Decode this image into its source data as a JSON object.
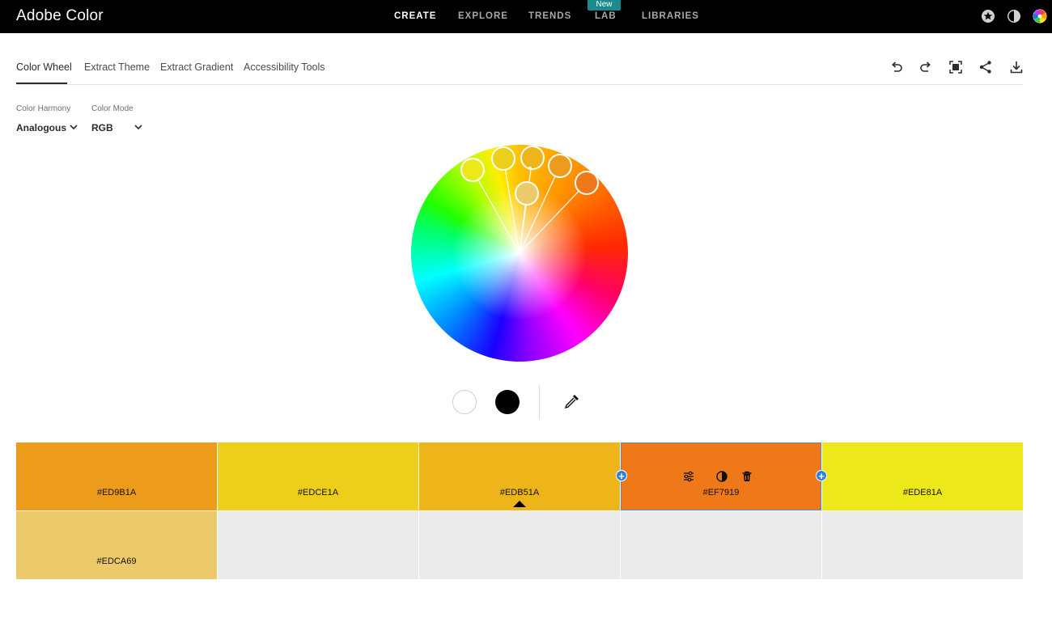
{
  "app": {
    "title": "Adobe Color"
  },
  "nav": {
    "items": [
      {
        "label": "CREATE",
        "active": true
      },
      {
        "label": "EXPLORE",
        "active": false
      },
      {
        "label": "TRENDS",
        "active": false
      },
      {
        "label": "LAB",
        "active": false
      },
      {
        "label": "LIBRARIES",
        "active": false
      }
    ],
    "badge": "New"
  },
  "subtabs": [
    {
      "label": "Color Wheel",
      "active": true
    },
    {
      "label": "Extract Theme",
      "active": false
    },
    {
      "label": "Extract Gradient",
      "active": false
    },
    {
      "label": "Accessibility Tools",
      "active": false
    }
  ],
  "controls": {
    "harmony_label": "Color Harmony",
    "harmony_value": "Analogous",
    "mode_label": "Color Mode",
    "mode_value": "RGB"
  },
  "swatches": [
    {
      "hex": "#ED9B1A",
      "color": "#ED9B1A"
    },
    {
      "hex": "#EDCE1A",
      "color": "#EDCE1A"
    },
    {
      "hex": "#EDB51A",
      "color": "#EDB51A"
    },
    {
      "hex": "#EF7919",
      "color": "#EF7919"
    },
    {
      "hex": "#EDE81A",
      "color": "#EDE81A"
    },
    {
      "hex": "#EDCA69",
      "color": "#EDCA69"
    }
  ],
  "colors": {
    "accent": "#2f7fe0",
    "topbar": "#000000",
    "empty_slot": "#ebebeb"
  }
}
